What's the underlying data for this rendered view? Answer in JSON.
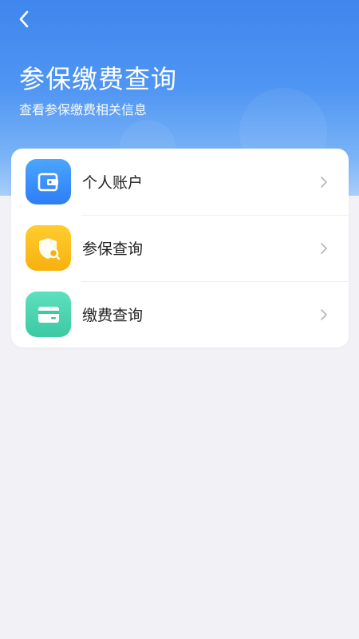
{
  "header": {
    "title": "参保缴费查询",
    "subtitle": "查看参保缴费相关信息",
    "back_icon": "chevron-left-icon"
  },
  "menu": {
    "items": [
      {
        "label": "个人账户",
        "icon": "wallet-icon",
        "icon_color": "#3a8cf8"
      },
      {
        "label": "参保查询",
        "icon": "shield-search-icon",
        "icon_color": "#f9bd1c"
      },
      {
        "label": "缴费查询",
        "icon": "card-icon",
        "icon_color": "#46d2ac"
      }
    ],
    "chevron_icon": "chevron-right-icon"
  },
  "colors": {
    "header_bg": "#4a8ff2",
    "page_bg": "#f1f1f6",
    "card_bg": "#ffffff",
    "text_primary": "#222222"
  }
}
